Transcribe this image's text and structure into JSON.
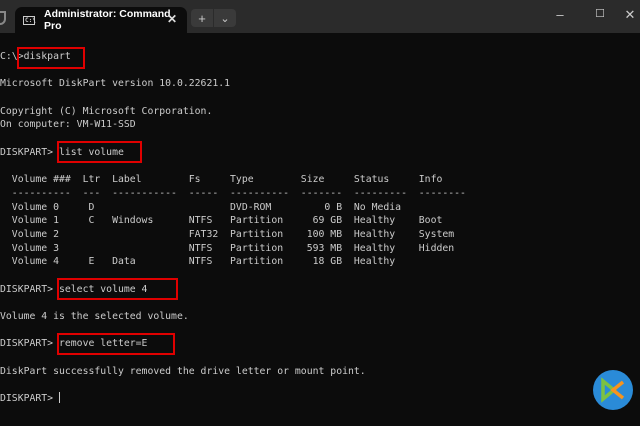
{
  "window": {
    "tab_title": "Administrator: Command Pro",
    "new_tab": "+",
    "dropdown": "⌄",
    "minimize": "–",
    "maximize": "☐",
    "close": "✕",
    "tab_close": "✕",
    "tab_icon": "C:\\"
  },
  "terminal": {
    "lines": [
      "C:\\>diskpart",
      "",
      "Microsoft DiskPart version 10.0.22621.1",
      "",
      "Copyright (C) Microsoft Corporation.",
      "On computer: VM-W11-SSD",
      "",
      "DISKPART> list volume",
      "",
      "  Volume ###  Ltr  Label        Fs     Type        Size     Status     Info",
      "  ----------  ---  -----------  -----  ----------  -------  ---------  --------",
      "  Volume 0     D                       DVD-ROM         0 B  No Media",
      "  Volume 1     C   Windows      NTFS   Partition     69 GB  Healthy    Boot",
      "  Volume 2                      FAT32  Partition    100 MB  Healthy    System",
      "  Volume 3                      NTFS   Partition    593 MB  Healthy    Hidden",
      "  Volume 4     E   Data         NTFS   Partition     18 GB  Healthy",
      "",
      "DISKPART> select volume 4",
      "",
      "Volume 4 is the selected volume.",
      "",
      "DISKPART> remove letter=E",
      "",
      "DiskPart successfully removed the drive letter or mount point.",
      "",
      "DISKPART> "
    ]
  },
  "colors": {
    "highlight": "#e00000",
    "logo_bg": "#2a8bd8"
  }
}
